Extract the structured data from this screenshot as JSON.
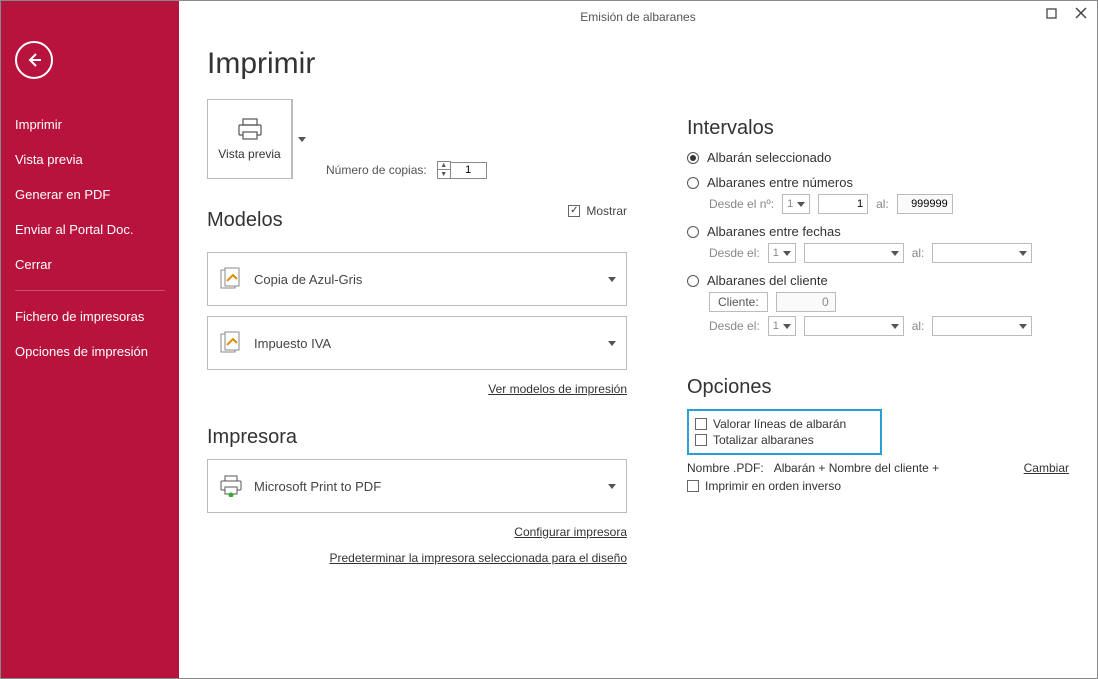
{
  "window": {
    "title": "Emisión de albaranes"
  },
  "sidebar": {
    "items": [
      "Imprimir",
      "Vista previa",
      "Generar en PDF",
      "Enviar al Portal Doc.",
      "Cerrar"
    ],
    "items2": [
      "Fichero de impresoras",
      "Opciones de impresión"
    ]
  },
  "header": {
    "title": "Imprimir"
  },
  "preview": {
    "button_label": "Vista previa",
    "copies_label": "Número de copias:",
    "copies_value": "1"
  },
  "modelos": {
    "title": "Modelos",
    "show_label": "Mostrar",
    "item1": "Copia de Azul-Gris",
    "item2": "Impuesto IVA",
    "link": "Ver modelos de impresión"
  },
  "impresora": {
    "title": "Impresora",
    "printer": "Microsoft Print to PDF",
    "config_link": "Configurar impresora",
    "preset_link": "Predeterminar la impresora seleccionada para el diseño"
  },
  "intervalos": {
    "title": "Intervalos",
    "r1": "Albarán seleccionado",
    "r2": "Albaranes entre números",
    "r2_from": "Desde el nº:",
    "r2_from_v": "1",
    "r2_to_lbl": "al:",
    "r2_to_v": "999999",
    "r3": "Albaranes entre fechas",
    "r3_from": "Desde el:",
    "r3_from_v": "1",
    "r3_to_lbl": "al:",
    "r4": "Albaranes del cliente",
    "r4_client_lbl": "Cliente:",
    "r4_client_v": "0",
    "r4_from": "Desde el:",
    "r4_from_v": "1",
    "r4_to_lbl": "al:"
  },
  "opciones": {
    "title": "Opciones",
    "o1": "Valorar líneas de albarán",
    "o2": "Totalizar albaranes",
    "pdf_name_lbl": "Nombre .PDF:",
    "pdf_name_val": "Albarán + Nombre del cliente +",
    "cambiar": "Cambiar",
    "o3": "Imprimir en orden inverso"
  }
}
